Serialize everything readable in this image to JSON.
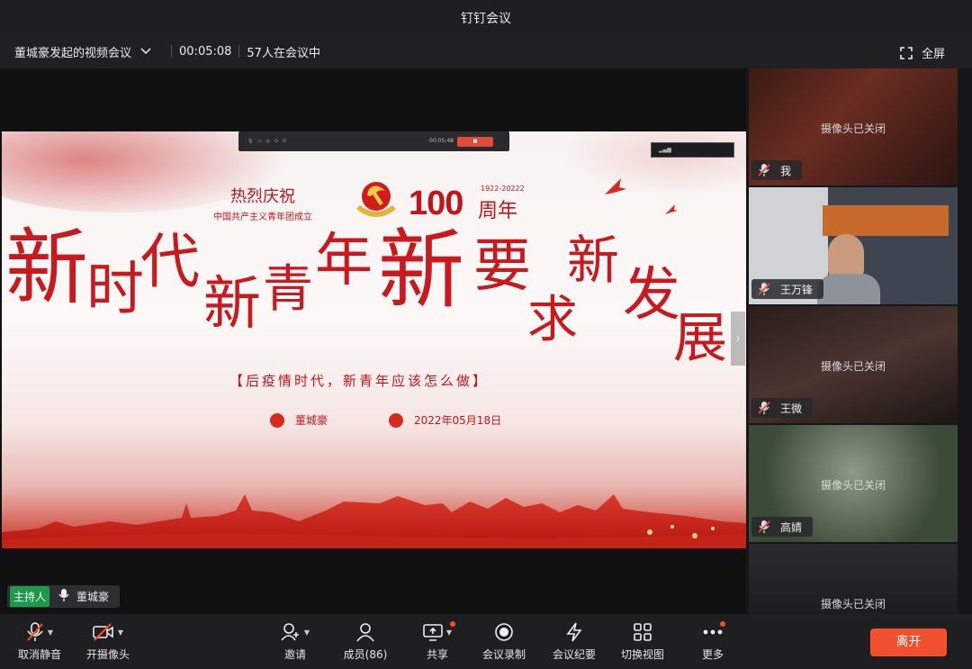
{
  "window": {
    "title": "钉钉会议"
  },
  "meeting": {
    "name": "董城豪发起的视频会议",
    "duration": "00:05:08",
    "participants_text": "57人在会议中",
    "fullscreen_label": "全屏"
  },
  "slide": {
    "celebrate": "热烈庆祝",
    "org": "中国共产主义青年团成立",
    "years": "1922-20222",
    "hundred": "100",
    "anniversary": "周年",
    "headline": {
      "c1": "新",
      "c2": "时",
      "c3": "代",
      "c4": "新",
      "c5": "青",
      "c6": "年",
      "c7": "新",
      "c8": "要",
      "c9": "求",
      "c10": "新",
      "c11": "发",
      "c12": "展"
    },
    "subtitle": "【后疫情时代，新青年应该怎么做】",
    "presenter": "董城豪",
    "date": "2022年05月18日",
    "share_time": "00:05:48"
  },
  "speaker": {
    "role_badge": "主持人",
    "name": "董城豪"
  },
  "participants": [
    {
      "name": "我",
      "status": "摄像头已关闭"
    },
    {
      "name": "王万锋",
      "status": ""
    },
    {
      "name": "王微",
      "status": "摄像头已关闭"
    },
    {
      "name": "高婧",
      "status": "摄像头已关闭"
    },
    {
      "name": "",
      "status": "摄像头已关闭"
    }
  ],
  "toolbar": {
    "mute": "取消静音",
    "camera": "开摄像头",
    "invite": "邀请",
    "members": "成员(86)",
    "share": "共享",
    "record": "会议录制",
    "minutes": "会议纪要",
    "layout": "切换视图",
    "more": "更多",
    "leave": "离开"
  },
  "colors": {
    "accent_red": "#c8191e",
    "leave": "#f2502f",
    "host_badge": "#1b9a4b"
  }
}
